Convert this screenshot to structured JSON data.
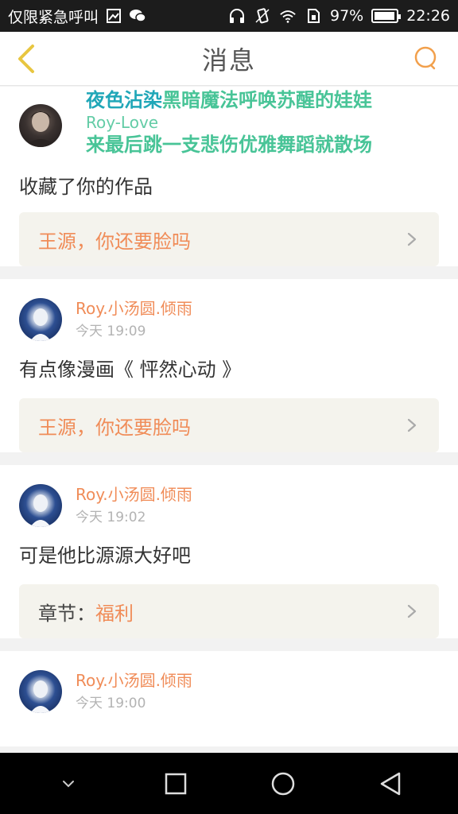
{
  "status_bar": {
    "carrier": "仅限紧急呼叫",
    "battery": "97%",
    "battery_level": 0.97,
    "time": "22:26",
    "icons": [
      "image-icon",
      "wechat-icon",
      "headset-icon",
      "vibrate-icon",
      "wifi-icon",
      "sim-icon",
      "battery-icon"
    ]
  },
  "header": {
    "title": "消息"
  },
  "overlay": {
    "line1_a": "夜色沾染",
    "line1_b": "黑暗魔法呼唤苏醒的娃娃",
    "line2": "Roy-Love",
    "line3": "来最后跳一支悲伤优雅舞蹈就散场"
  },
  "messages": [
    {
      "message": "收藏了你的作品",
      "link_text": "王源，你还要脸吗"
    },
    {
      "username": "Roy.小汤圆.倾雨",
      "time": "今天 19:09",
      "message": "有点像漫画《 怦然心动 》",
      "link_text": "王源，你还要脸吗"
    },
    {
      "username": "Roy.小汤圆.倾雨",
      "time": "今天 19:02",
      "message": "可是他比源源大好吧",
      "link_prefix": "章节：",
      "link_text": "福利"
    },
    {
      "username": "Roy.小汤圆.倾雨",
      "time": "今天 19:00"
    }
  ],
  "colors": {
    "accent": "#f08c58",
    "back_icon": "#e8c640",
    "search_icon": "#f2a04c",
    "link_bg": "#f4f3ed"
  }
}
